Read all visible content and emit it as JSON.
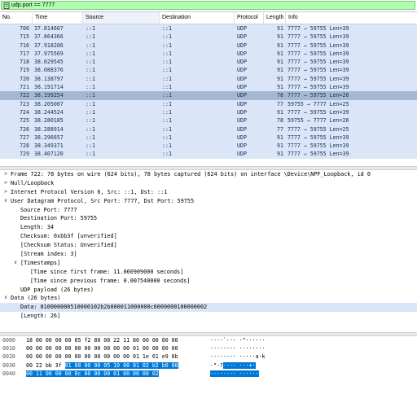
{
  "filter": {
    "value": "udp.port == 7777"
  },
  "columns": {
    "no": "No.",
    "time": "Time",
    "source": "Source",
    "destination": "Destination",
    "protocol": "Protocol",
    "length": "Length",
    "info": "Info"
  },
  "packets": [
    {
      "no": "706",
      "time": "37.814607",
      "src": "::1",
      "dst": "::1",
      "proto": "UDP",
      "len": "91",
      "info": "7777 → 59755 Len=39"
    },
    {
      "no": "715",
      "time": "37.864366",
      "src": "::1",
      "dst": "::1",
      "proto": "UDP",
      "len": "91",
      "info": "7777 → 59755 Len=39"
    },
    {
      "no": "716",
      "time": "37.918206",
      "src": "::1",
      "dst": "::1",
      "proto": "UDP",
      "len": "91",
      "info": "7777 → 59755 Len=39"
    },
    {
      "no": "717",
      "time": "37.975569",
      "src": "::1",
      "dst": "::1",
      "proto": "UDP",
      "len": "91",
      "info": "7777 → 59755 Len=39"
    },
    {
      "no": "718",
      "time": "38.029545",
      "src": "::1",
      "dst": "::1",
      "proto": "UDP",
      "len": "91",
      "info": "7777 → 59755 Len=39"
    },
    {
      "no": "719",
      "time": "38.088376",
      "src": "::1",
      "dst": "::1",
      "proto": "UDP",
      "len": "91",
      "info": "7777 → 59755 Len=39"
    },
    {
      "no": "720",
      "time": "38.138797",
      "src": "::1",
      "dst": "::1",
      "proto": "UDP",
      "len": "91",
      "info": "7777 → 59755 Len=39"
    },
    {
      "no": "721",
      "time": "38.191714",
      "src": "::1",
      "dst": "::1",
      "proto": "UDP",
      "len": "91",
      "info": "7777 → 59755 Len=39"
    },
    {
      "no": "722",
      "time": "38.199254",
      "src": "::1",
      "dst": "::1",
      "proto": "UDP",
      "len": "78",
      "info": "7777 → 59755 Len=26",
      "selected": true
    },
    {
      "no": "723",
      "time": "38.205007",
      "src": "::1",
      "dst": "::1",
      "proto": "UDP",
      "len": "77",
      "info": "59755 → 7777 Len=25"
    },
    {
      "no": "724",
      "time": "38.244524",
      "src": "::1",
      "dst": "::1",
      "proto": "UDP",
      "len": "91",
      "info": "7777 → 59755 Len=39"
    },
    {
      "no": "725",
      "time": "38.280185",
      "src": "::1",
      "dst": "::1",
      "proto": "UDP",
      "len": "78",
      "info": "59755 → 7777 Len=26"
    },
    {
      "no": "726",
      "time": "38.288914",
      "src": "::1",
      "dst": "::1",
      "proto": "UDP",
      "len": "77",
      "info": "7777 → 59755 Len=25"
    },
    {
      "no": "727",
      "time": "38.296657",
      "src": "::1",
      "dst": "::1",
      "proto": "UDP",
      "len": "91",
      "info": "7777 → 59755 Len=39"
    },
    {
      "no": "728",
      "time": "38.349371",
      "src": "::1",
      "dst": "::1",
      "proto": "UDP",
      "len": "91",
      "info": "7777 → 59755 Len=39"
    },
    {
      "no": "729",
      "time": "38.407120",
      "src": "::1",
      "dst": "::1",
      "proto": "UDP",
      "len": "91",
      "info": "7777 → 59755 Len=39"
    }
  ],
  "details": [
    {
      "indent": 0,
      "arrow": ">",
      "text": "Frame 722: 78 bytes on wire (624 bits), 78 bytes captured (624 bits) on interface \\Device\\NPF_Loopback, id 0"
    },
    {
      "indent": 0,
      "arrow": ">",
      "text": "Null/Loopback"
    },
    {
      "indent": 0,
      "arrow": ">",
      "text": "Internet Protocol Version 6, Src: ::1, Dst: ::1"
    },
    {
      "indent": 0,
      "arrow": "v",
      "text": "User Datagram Protocol, Src Port: 7777, Dst Port: 59755"
    },
    {
      "indent": 1,
      "arrow": "",
      "text": "Source Port: 7777"
    },
    {
      "indent": 1,
      "arrow": "",
      "text": "Destination Port: 59755"
    },
    {
      "indent": 1,
      "arrow": "",
      "text": "Length: 34"
    },
    {
      "indent": 1,
      "arrow": "",
      "text": "Checksum: 0xbb3f [unverified]"
    },
    {
      "indent": 1,
      "arrow": "",
      "text": "[Checksum Status: Unverified]"
    },
    {
      "indent": 1,
      "arrow": "",
      "text": "[Stream index: 3]"
    },
    {
      "indent": 1,
      "arrow": "v",
      "text": "[Timestamps]"
    },
    {
      "indent": 2,
      "arrow": "",
      "text": "[Time since first frame: 11.060909000 seconds]"
    },
    {
      "indent": 2,
      "arrow": "",
      "text": "[Time since previous frame: 0.007540000 seconds]"
    },
    {
      "indent": 1,
      "arrow": "",
      "text": "UDP payload (26 bytes)"
    },
    {
      "indent": 0,
      "arrow": "v",
      "text": "Data (26 bytes)"
    },
    {
      "indent": 1,
      "arrow": "",
      "text": "Data: 010000000510000102b2b000011000000c0000000100000002",
      "highlight": true
    },
    {
      "indent": 1,
      "arrow": "",
      "text": "[Length: 26]"
    }
  ],
  "bytes": [
    {
      "off": "0000",
      "hex": "18 00 00 00 60 05 f2 80  00 22 11 80 00 00 00 00",
      "sel_hex": "",
      "asc": "····`··· ·\"······",
      "sel_asc": ""
    },
    {
      "off": "0010",
      "hex": "00 00 00 00 00 00 00 00  00 00 00 01 00 00 00 00",
      "sel_hex": "",
      "asc": "········ ········",
      "sel_asc": ""
    },
    {
      "off": "0020",
      "hex": "00 00 00 00 00 00 00 00  00 00 00 01 1e 61 e9 6b",
      "sel_hex": "",
      "asc": "········ ·····a·k",
      "sel_asc": ""
    },
    {
      "off": "0030",
      "hex": "00 22 bb 3f ",
      "sel_hex": "01 00 00 00  05 10 00 01 02 b2 b0 00",
      "asc": "·\"·?",
      "sel_asc": "···· ···+·"
    },
    {
      "off": "0040",
      "hex": "",
      "sel_hex": "00 11 00 00 00 0c 00 00  00 01 00 00 00 02",
      "asc": "",
      "sel_asc": "········ ······"
    }
  ],
  "colors": {
    "filter_bg": "#afffaf",
    "row_bg": "#dae6f7",
    "row_sel": "#a6b8d1",
    "byte_sel": "#0078d7"
  }
}
